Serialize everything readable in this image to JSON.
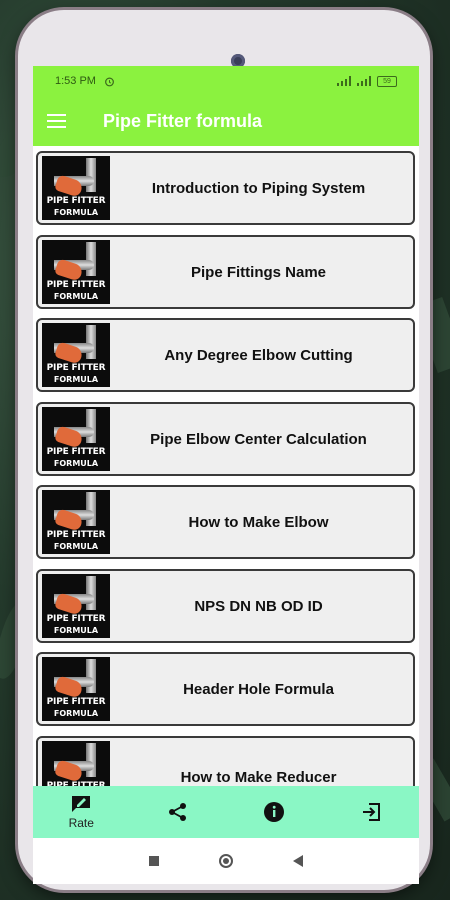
{
  "status": {
    "time": "1:53 PM",
    "battery": "59"
  },
  "app": {
    "title": "Pipe Fitter formula"
  },
  "thumbnail": {
    "line1": "PIPE FITTER",
    "line2": "FORMULA"
  },
  "items": [
    {
      "label": "Introduction to Piping System"
    },
    {
      "label": "Pipe Fittings Name"
    },
    {
      "label": "Any Degree Elbow Cutting"
    },
    {
      "label": "Pipe Elbow Center Calculation"
    },
    {
      "label": "How to Make Elbow"
    },
    {
      "label": "NPS DN NB OD ID"
    },
    {
      "label": "Header Hole Formula"
    },
    {
      "label": "How to Make Reducer"
    }
  ],
  "bottom_nav": {
    "rate_label": "Rate",
    "items": [
      {
        "icon": "rate-icon"
      },
      {
        "icon": "share-icon"
      },
      {
        "icon": "info-icon"
      },
      {
        "icon": "exit-icon"
      }
    ]
  },
  "colors": {
    "appbar": "#8bf23f",
    "bottom_nav": "#8af7c5",
    "card_bg": "#efefef"
  }
}
